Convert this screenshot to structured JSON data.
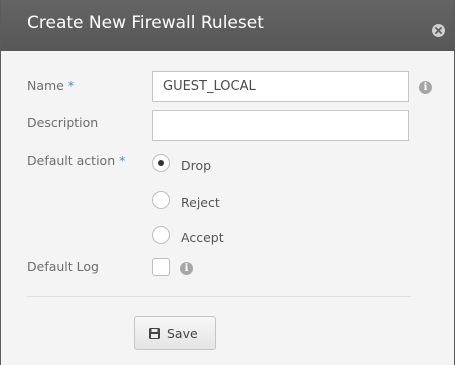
{
  "dialog": {
    "title": "Create New Firewall Ruleset",
    "close_icon": "close-icon"
  },
  "form": {
    "name": {
      "label": "Name",
      "required_marker": "*",
      "value": "GUEST_LOCAL",
      "info_icon": "info-icon"
    },
    "description": {
      "label": "Description",
      "value": ""
    },
    "default_action": {
      "label": "Default action",
      "required_marker": "*",
      "options": [
        {
          "label": "Drop",
          "selected": true
        },
        {
          "label": "Reject",
          "selected": false
        },
        {
          "label": "Accept",
          "selected": false
        }
      ]
    },
    "default_log": {
      "label": "Default Log",
      "checked": false,
      "info_icon": "info-icon"
    }
  },
  "actions": {
    "save_label": "Save",
    "save_icon": "floppy-disk-icon"
  },
  "colors": {
    "titlebar": "#5e5e5e",
    "required_marker": "#3a8fd6",
    "dialog_background": "#f4f4f4"
  }
}
